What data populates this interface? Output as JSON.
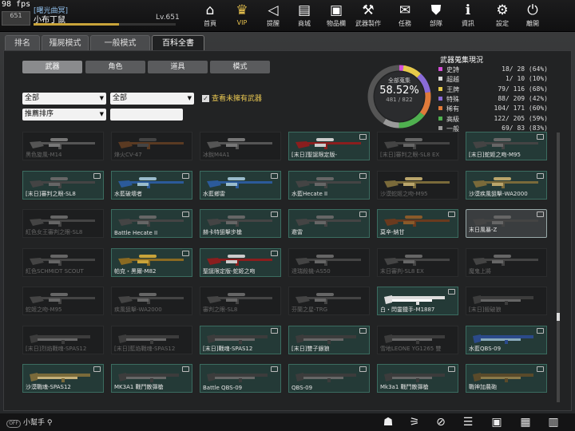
{
  "fps": "98 fps",
  "player": {
    "clan": "[曙光曲冥]",
    "name": "小布丁鼠",
    "level": "Lv.651",
    "rank_label": "651",
    "xp_fraction": 0.6
  },
  "nav": [
    {
      "label": "首頁",
      "icon": "home-icon",
      "glyph": "⌂"
    },
    {
      "label": "VIP",
      "icon": "crown-icon",
      "glyph": "♛"
    },
    {
      "label": "提醒",
      "icon": "megaphone-icon",
      "glyph": "◁"
    },
    {
      "label": "商城",
      "icon": "shop-icon",
      "glyph": "▤"
    },
    {
      "label": "物品欄",
      "icon": "briefcase-icon",
      "glyph": "▣"
    },
    {
      "label": "武器製作",
      "icon": "hammer-icon",
      "glyph": "⚒"
    },
    {
      "label": "任務",
      "icon": "ticket-icon",
      "glyph": "✉"
    },
    {
      "label": "部隊",
      "icon": "shield-icon",
      "glyph": "⛊"
    },
    {
      "label": "資訊",
      "icon": "info-icon",
      "glyph": "ℹ"
    },
    {
      "label": "設定",
      "icon": "gear-icon",
      "glyph": "⚙"
    },
    {
      "label": "離開",
      "icon": "exit-icon",
      "glyph": "⏻"
    }
  ],
  "tabs": [
    "排名",
    "殭屍模式",
    "一般模式",
    "百科全書"
  ],
  "subtabs": [
    "武器",
    "角色",
    "道具",
    "模式"
  ],
  "filters": {
    "category": "全部",
    "subcategory": "全部",
    "sort": "推薦排序",
    "search_value": "",
    "own_label": "查看未擁有武器",
    "own_checked": true
  },
  "stats": {
    "title": "武器蒐集現況",
    "center_label": "全部蒐集",
    "percent": "58.52%",
    "count": "481 / 822",
    "rows": [
      {
        "name": "史詩",
        "have": "18",
        "total": "28",
        "pct": "(64%)",
        "color": "#d44fd8",
        "ratio": 0.64
      },
      {
        "name": "超越",
        "have": "1",
        "total": "10",
        "pct": "(10%)",
        "color": "#d9d9d9",
        "ratio": 0.1
      },
      {
        "name": "王牌",
        "have": "79",
        "total": "116",
        "pct": "(68%)",
        "color": "#e6c94a",
        "ratio": 0.68
      },
      {
        "name": "特殊",
        "have": "88",
        "total": "209",
        "pct": "(42%)",
        "color": "#8a6bd8",
        "ratio": 0.42
      },
      {
        "name": "稀有",
        "have": "104",
        "total": "171",
        "pct": "(60%)",
        "color": "#e07a3a",
        "ratio": 0.6
      },
      {
        "name": "高級",
        "have": "122",
        "total": "205",
        "pct": "(59%)",
        "color": "#4fb04f",
        "ratio": 0.59
      },
      {
        "name": "一般",
        "have": "69",
        "total": "83",
        "pct": "(83%)",
        "color": "#9a9a9a",
        "ratio": 0.83
      }
    ]
  },
  "weapons": [
    {
      "name": "黑色旋風-M14",
      "owned": false,
      "kind": "rifle"
    },
    {
      "name": "烽火CV-47",
      "owned": false,
      "kind": "ak"
    },
    {
      "name": "冰銳M4A1",
      "owned": false,
      "kind": "rifle"
    },
    {
      "name": "[末日]聖誕限定版-",
      "owned": true,
      "kind": "sniper-red"
    },
    {
      "name": "[末日]審判之眼-SL8 EX",
      "owned": false,
      "kind": "sniper"
    },
    {
      "name": "[末日]蛇姬之吻-M95",
      "owned": true,
      "kind": "sniper"
    },
    {
      "name": "[末日]審判之眼-SL8",
      "owned": true,
      "kind": "sniper"
    },
    {
      "name": "水藍破壞者",
      "owned": true,
      "kind": "sniper-blue"
    },
    {
      "name": "水藍鄉雷",
      "owned": true,
      "kind": "sniper-blue"
    },
    {
      "name": "水藍Hecate II",
      "owned": true,
      "kind": "sniper"
    },
    {
      "name": "沙漠蛇姬之吻-M95",
      "owned": false,
      "kind": "sniper-tan"
    },
    {
      "name": "沙漠疾風狙擊-WA2000",
      "owned": true,
      "kind": "sniper-tan"
    },
    {
      "name": "紅色女王審判之眼-SL8",
      "owned": false,
      "kind": "sniper"
    },
    {
      "name": "Battle Hecate II",
      "owned": true,
      "kind": "sniper"
    },
    {
      "name": "赫卡特狙擊步槍",
      "owned": true,
      "kind": "sniper"
    },
    {
      "name": "邀雷",
      "owned": true,
      "kind": "sniper"
    },
    {
      "name": "莫辛-納甘",
      "owned": true,
      "kind": "bolt-wood"
    },
    {
      "name": "末日風暴-Z",
      "owned": true,
      "kind": "sniper",
      "selected": true
    },
    {
      "name": "紅色SCHMIDT SCOUT",
      "owned": false,
      "kind": "sniper"
    },
    {
      "name": "帕克・黑爾-M82",
      "owned": true,
      "kind": "sniper-gold"
    },
    {
      "name": "聖誕限定版-蛇姬之吻",
      "owned": true,
      "kind": "sniper-red"
    },
    {
      "name": "達瑞殺機-AS50",
      "owned": false,
      "kind": "sniper"
    },
    {
      "name": "末日審判-SL8 EX",
      "owned": false,
      "kind": "sniper"
    },
    {
      "name": "魔鬼上將",
      "owned": false,
      "kind": "sniper"
    },
    {
      "name": "蛇姬之吻-M95",
      "owned": false,
      "kind": "sniper"
    },
    {
      "name": "疾風狙擊-WA2000",
      "owned": false,
      "kind": "sniper"
    },
    {
      "name": "審判之眼-SL8",
      "owned": false,
      "kind": "sniper"
    },
    {
      "name": "芬蘭之星-TRG",
      "owned": false,
      "kind": "sniper"
    },
    {
      "name": "白・閃靈獵手-M1887",
      "owned": true,
      "kind": "lever-white"
    },
    {
      "name": "[末日]殺破狼",
      "owned": false,
      "kind": "shotgun"
    },
    {
      "name": "[末日]烈焰戰魂-SPAS12",
      "owned": false,
      "kind": "shotgun"
    },
    {
      "name": "[末日]藍焰戰魂-SPAS12",
      "owned": false,
      "kind": "shotgun"
    },
    {
      "name": "[末日]戰魂-SPAS12",
      "owned": true,
      "kind": "shotgun"
    },
    {
      "name": "[末日]雙子銀狼",
      "owned": true,
      "kind": "shotgun"
    },
    {
      "name": "雪地LEONE YG1265 雙",
      "owned": false,
      "kind": "shotgun"
    },
    {
      "name": "水藍QBS-09",
      "owned": true,
      "kind": "shotgun-blue"
    },
    {
      "name": "沙漠戰魂-SPAS12",
      "owned": true,
      "kind": "shotgun-tan"
    },
    {
      "name": "MK3A1 戰鬥散彈槍",
      "owned": true,
      "kind": "shotgun"
    },
    {
      "name": "Battle QBS-09",
      "owned": true,
      "kind": "shotgun"
    },
    {
      "name": "QBS-09",
      "owned": true,
      "kind": "shotgun"
    },
    {
      "name": "Mk3a1 戰鬥散彈槍",
      "owned": true,
      "kind": "shotgun"
    },
    {
      "name": "戰神加農砲",
      "owned": true,
      "kind": "shotgun-heavy"
    }
  ],
  "bottom": {
    "helper": "小幫手",
    "helper_badge": "OFF"
  },
  "bottom_icons": [
    "run-icon",
    "cart-icon",
    "compass-icon",
    "list-check-icon",
    "card-icon",
    "calendar-check-icon",
    "film-icon"
  ]
}
